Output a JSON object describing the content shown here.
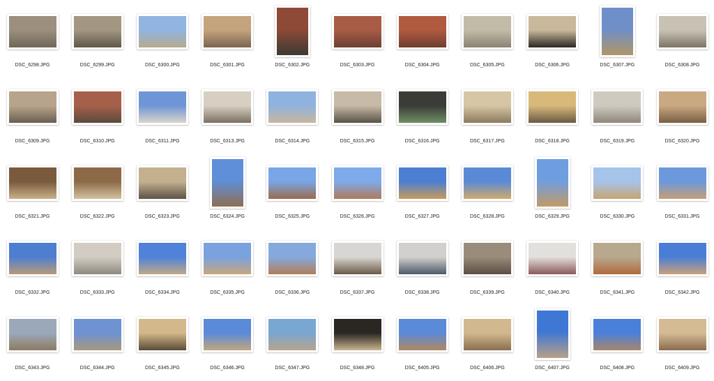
{
  "thumbnails": [
    {
      "name": "DSC_6298.JPG",
      "orientation": "landscape",
      "colors": [
        "#9c8f7e",
        "#6f6659"
      ]
    },
    {
      "name": "DSC_6299.JPG",
      "orientation": "landscape",
      "colors": [
        "#a39782",
        "#5f5648"
      ]
    },
    {
      "name": "DSC_6300.JPG",
      "orientation": "landscape",
      "colors": [
        "#8fb5e0",
        "#b8a98e"
      ]
    },
    {
      "name": "DSC_6301.JPG",
      "orientation": "landscape",
      "colors": [
        "#c4a47c",
        "#7a6450"
      ]
    },
    {
      "name": "DSC_6302.JPG",
      "orientation": "portrait",
      "colors": [
        "#8e4a36",
        "#3c3a34"
      ]
    },
    {
      "name": "DSC_6303.JPG",
      "orientation": "landscape",
      "colors": [
        "#a85c45",
        "#6a4032"
      ]
    },
    {
      "name": "DSC_6304.JPG",
      "orientation": "landscape",
      "colors": [
        "#b05a40",
        "#6e3e2e"
      ]
    },
    {
      "name": "DSC_6305.JPG",
      "orientation": "landscape",
      "colors": [
        "#c2bba8",
        "#8a8372"
      ]
    },
    {
      "name": "DSC_6306.JPG",
      "orientation": "landscape",
      "colors": [
        "#c9b89c",
        "#2b2823"
      ]
    },
    {
      "name": "DSC_6307.JPG",
      "orientation": "portrait",
      "colors": [
        "#6f8fc9",
        "#b09668"
      ]
    },
    {
      "name": "DSC_6308.JPG",
      "orientation": "landscape",
      "colors": [
        "#c8c2b5",
        "#7c7466"
      ]
    },
    {
      "name": "DSC_6309.JPG",
      "orientation": "landscape",
      "colors": [
        "#b8a48c",
        "#6b5f52"
      ]
    },
    {
      "name": "DSC_6310.JPG",
      "orientation": "landscape",
      "colors": [
        "#a6604a",
        "#5b4a3c"
      ]
    },
    {
      "name": "DSC_6311.JPG",
      "orientation": "landscape",
      "colors": [
        "#6e96d6",
        "#d9d4ca"
      ]
    },
    {
      "name": "DSC_6313.JPG",
      "orientation": "landscape",
      "colors": [
        "#d7cfc2",
        "#7a7062"
      ]
    },
    {
      "name": "DSC_6314.JPG",
      "orientation": "landscape",
      "colors": [
        "#8fb2df",
        "#c9b79c"
      ]
    },
    {
      "name": "DSC_6315.JPG",
      "orientation": "landscape",
      "colors": [
        "#c7baa6",
        "#5a5248"
      ]
    },
    {
      "name": "DSC_6316.JPG",
      "orientation": "landscape",
      "colors": [
        "#3b3b38",
        "#6e8f63"
      ]
    },
    {
      "name": "DSC_6317.JPG",
      "orientation": "landscape",
      "colors": [
        "#d6c6a6",
        "#8c7a5e"
      ]
    },
    {
      "name": "DSC_6318.JPG",
      "orientation": "landscape",
      "colors": [
        "#d9b97a",
        "#6a5a44"
      ]
    },
    {
      "name": "DSC_6319.JPG",
      "orientation": "landscape",
      "colors": [
        "#cfcac0",
        "#8e877a"
      ]
    },
    {
      "name": "DSC_6320.JPG",
      "orientation": "landscape",
      "colors": [
        "#c9a982",
        "#7a5e42"
      ]
    },
    {
      "name": "DSC_6321.JPG",
      "orientation": "landscape",
      "colors": [
        "#7a5a3c",
        "#c9b08a"
      ]
    },
    {
      "name": "DSC_6322.JPG",
      "orientation": "landscape",
      "colors": [
        "#8c6a48",
        "#d3c1a0"
      ]
    },
    {
      "name": "DSC_6323.JPG",
      "orientation": "landscape",
      "colors": [
        "#c2b08f",
        "#5e5244"
      ]
    },
    {
      "name": "DSC_6324.JPG",
      "orientation": "portrait",
      "colors": [
        "#5f8fd8",
        "#8e6e52"
      ]
    },
    {
      "name": "DSC_6325.JPG",
      "orientation": "landscape",
      "colors": [
        "#78a6e6",
        "#9c6a4c"
      ]
    },
    {
      "name": "DSC_6326.JPG",
      "orientation": "landscape",
      "colors": [
        "#7eaaea",
        "#b07a5a"
      ]
    },
    {
      "name": "DSC_6327.JPG",
      "orientation": "landscape",
      "colors": [
        "#4c7fd2",
        "#c79a5a"
      ]
    },
    {
      "name": "DSC_6328.JPG",
      "orientation": "landscape",
      "colors": [
        "#5a8ad6",
        "#d1aa6a"
      ]
    },
    {
      "name": "DSC_6329.JPG",
      "orientation": "portrait",
      "colors": [
        "#6e9ee0",
        "#c29a66"
      ]
    },
    {
      "name": "DSC_6330.JPG",
      "orientation": "landscape",
      "colors": [
        "#a6c4ea",
        "#c8a472"
      ]
    },
    {
      "name": "DSC_6331.JPG",
      "orientation": "landscape",
      "colors": [
        "#6c98dc",
        "#c69e74"
      ]
    },
    {
      "name": "DSC_6332.JPG",
      "orientation": "landscape",
      "colors": [
        "#4e7ed0",
        "#b89a78"
      ]
    },
    {
      "name": "DSC_6333.JPG",
      "orientation": "landscape",
      "colors": [
        "#d2ccc2",
        "#8f8a80"
      ]
    },
    {
      "name": "DSC_6334.JPG",
      "orientation": "landscape",
      "colors": [
        "#4f82d8",
        "#bfa888"
      ]
    },
    {
      "name": "DSC_6335.JPG",
      "orientation": "landscape",
      "colors": [
        "#79a2de",
        "#c9a67e"
      ]
    },
    {
      "name": "DSC_6336.JPG",
      "orientation": "landscape",
      "colors": [
        "#86a9dd",
        "#b07e58"
      ]
    },
    {
      "name": "DSC_6337.JPG",
      "orientation": "landscape",
      "colors": [
        "#d8d6d2",
        "#6c5a48"
      ]
    },
    {
      "name": "DSC_6338.JPG",
      "orientation": "landscape",
      "colors": [
        "#d2d0cc",
        "#4e5a6a"
      ]
    },
    {
      "name": "DSC_6339.JPG",
      "orientation": "landscape",
      "colors": [
        "#9a8c7a",
        "#5c4e42"
      ]
    },
    {
      "name": "DSC_6340.JPG",
      "orientation": "landscape",
      "colors": [
        "#e2e0dc",
        "#8a5a5a"
      ]
    },
    {
      "name": "DSC_6341.JPG",
      "orientation": "landscape",
      "colors": [
        "#b8a88e",
        "#b06a3c"
      ]
    },
    {
      "name": "DSC_6342.JPG",
      "orientation": "landscape",
      "colors": [
        "#4a7ed6",
        "#c9a07a"
      ]
    },
    {
      "name": "DSC_6343.JPG",
      "orientation": "landscape",
      "colors": [
        "#9aa8ba",
        "#8e7a62"
      ]
    },
    {
      "name": "DSC_6344.JPG",
      "orientation": "landscape",
      "colors": [
        "#6e92d2",
        "#a8987e"
      ]
    },
    {
      "name": "DSC_6345.JPG",
      "orientation": "landscape",
      "colors": [
        "#d2b88a",
        "#5c4a36"
      ]
    },
    {
      "name": "DSC_6346.JPG",
      "orientation": "landscape",
      "colors": [
        "#5a8ad8",
        "#c2a67e"
      ]
    },
    {
      "name": "DSC_6347.JPG",
      "orientation": "landscape",
      "colors": [
        "#7aa6d2",
        "#b8a48a"
      ]
    },
    {
      "name": "DSC_6348.JPG",
      "orientation": "landscape",
      "colors": [
        "#2a2622",
        "#c9b48e"
      ]
    },
    {
      "name": "DSC_6405.JPG",
      "orientation": "landscape",
      "colors": [
        "#5a8ad8",
        "#b08862"
      ]
    },
    {
      "name": "DSC_6406.JPG",
      "orientation": "landscape",
      "colors": [
        "#d2b88e",
        "#8a6e4e"
      ]
    },
    {
      "name": "DSC_6407.JPG",
      "orientation": "portrait",
      "colors": [
        "#3f78d4",
        "#b8a088"
      ]
    },
    {
      "name": "DSC_6408.JPG",
      "orientation": "landscape",
      "colors": [
        "#4a80da",
        "#a8866a"
      ]
    },
    {
      "name": "DSC_6409.JPG",
      "orientation": "landscape",
      "colors": [
        "#d4bb94",
        "#8c6c4e"
      ]
    }
  ]
}
